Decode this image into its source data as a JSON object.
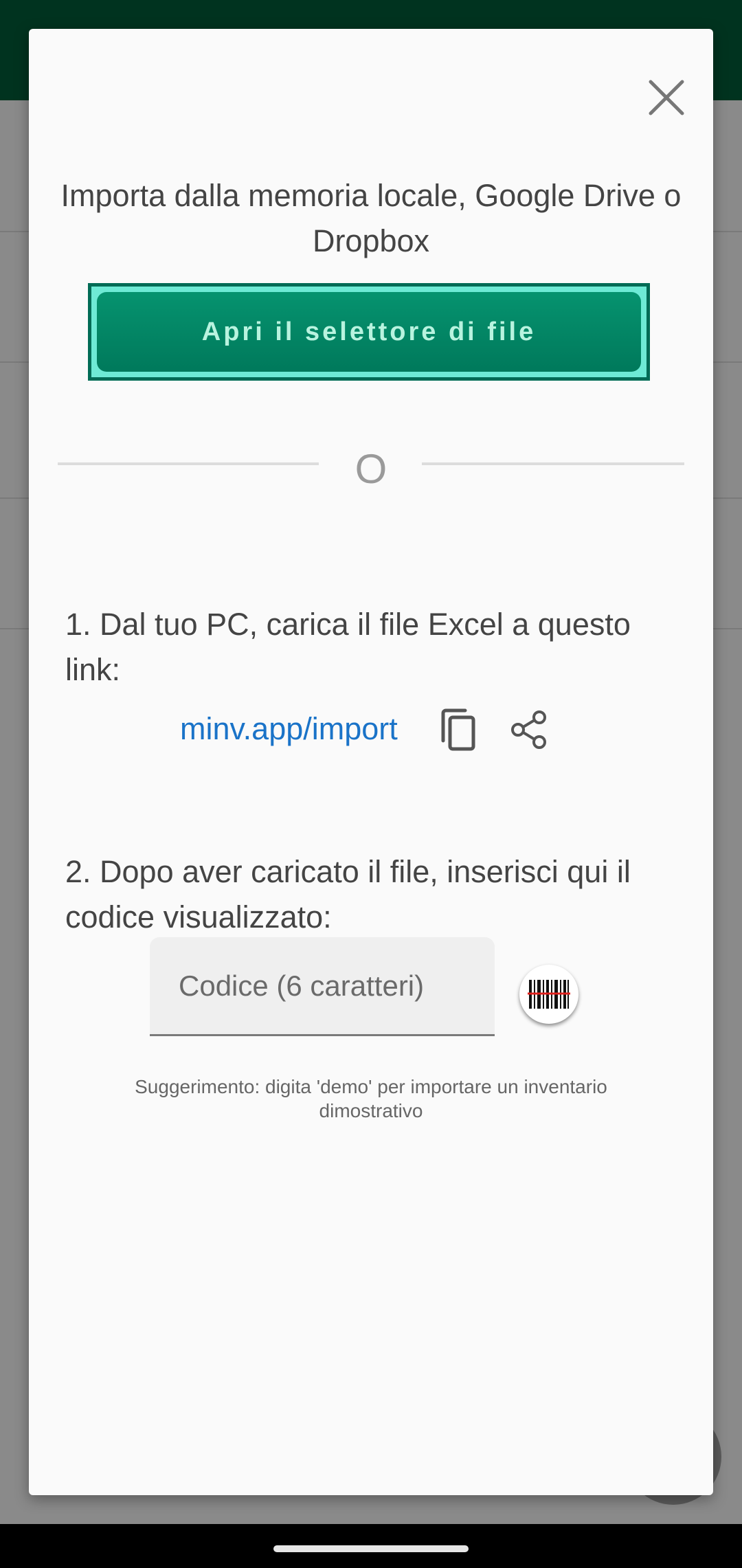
{
  "dialog": {
    "close_icon": "close-icon",
    "intro_text": "Importa dalla memoria locale, Google Drive o Dropbox",
    "file_picker_label": "Apri il selettore di file",
    "or_label": "O",
    "step1_text": "1. Dal tuo PC, carica il file Excel a questo link:",
    "import_link": "minv.app/import",
    "copy_icon": "copy-icon",
    "share_icon": "share-icon",
    "step2_text": "2. Dopo aver caricato il file, inserisci qui il codice visualizzato:",
    "code_field": {
      "value": "",
      "placeholder": "Codice (6 caratteri)"
    },
    "scan_icon": "barcode-scanner-icon",
    "hint_text": "Suggerimento: digita 'demo' per importare un inventario dimostrativo"
  },
  "colors": {
    "app_bar": "#00331f",
    "button_fill": "#00795b",
    "button_highlight": "#6eead5",
    "link": "#1a73c8"
  }
}
